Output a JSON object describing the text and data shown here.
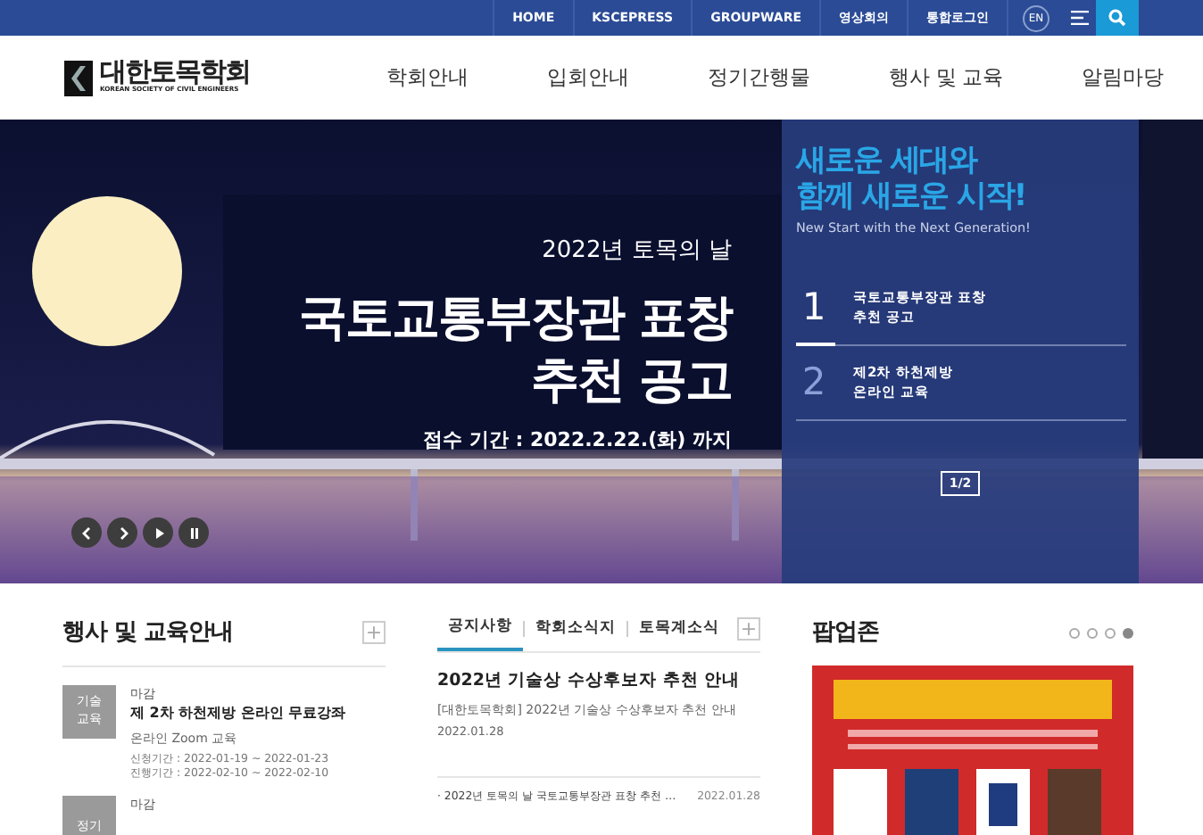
{
  "top_bar": {
    "links": [
      "HOME",
      "KSCEPRESS",
      "GROUPWARE",
      "영상회의",
      "통합로그인"
    ],
    "language": "EN"
  },
  "header": {
    "logo_title": "대한토목학회",
    "logo_subtitle": "KOREAN SOCIETY OF CIVIL ENGINEERS",
    "menu": [
      "학회안내",
      "입회안내",
      "정기간행물",
      "행사 및 교육",
      "알림마당"
    ]
  },
  "hero": {
    "kicker": "2022년 토목의 날",
    "headline": [
      "국토교통부장관 표창",
      "추천 공고"
    ],
    "period": "접수 기간 : 2022.2.22.(화) 까지",
    "panel": {
      "title": [
        "새로운 세대와",
        "함께 새로운 시작!"
      ],
      "subtitle": "New Start with the Next Generation!",
      "items": [
        {
          "number": "1",
          "lines": [
            "국토교통부장관 표창",
            "추천 공고"
          ],
          "selected": true
        },
        {
          "number": "2",
          "lines": [
            "제2차 하천제방",
            "온라인 교육"
          ],
          "selected": false
        }
      ],
      "pager": "1/2"
    }
  },
  "events": {
    "title": "행사 및 교육안내",
    "more": "+",
    "items": [
      {
        "category": [
          "기술",
          "교육"
        ],
        "status": "마감",
        "title": "제 2차 하천제방 온라인 무료강좌",
        "place": "온라인 Zoom 교육",
        "dates": [
          "신청기간 : 2022-01-19 ~ 2022-01-23",
          "진행기간 : 2022-02-10 ~ 2022-02-10"
        ]
      },
      {
        "category": [
          "정기"
        ],
        "status": "마감"
      }
    ]
  },
  "news": {
    "tabs": [
      {
        "label": "공지사항",
        "selected": true
      },
      {
        "label": "학회소식지",
        "selected": false
      },
      {
        "label": "토목계소식",
        "selected": false
      }
    ],
    "more": "+",
    "featured": {
      "title": "2022년 기술상 수상후보자 추천 안내",
      "summary": "[대한토목학회] 2022년 기술상 수상후보자 추천 안내",
      "date": "2022.01.28"
    },
    "list": [
      {
        "title": "· 2022년 토목의 날 국토교통부장관 표창 추천 …",
        "date": "2022.01.28"
      }
    ]
  },
  "popup": {
    "title": "팝업존",
    "dots": [
      {
        "selected": false
      },
      {
        "selected": false
      },
      {
        "selected": false
      },
      {
        "selected": true
      }
    ]
  }
}
